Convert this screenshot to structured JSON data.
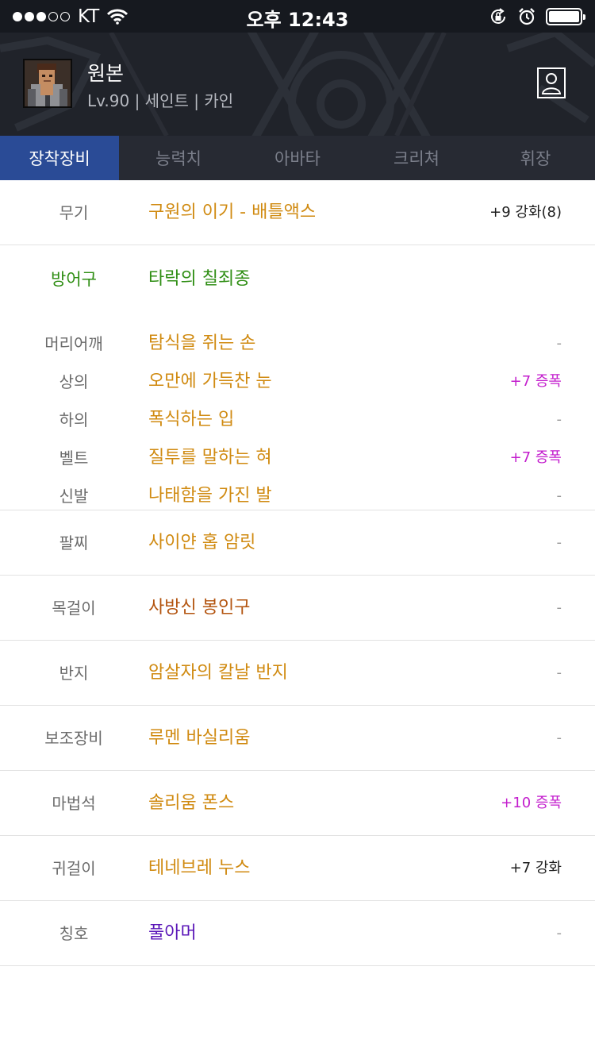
{
  "status_bar": {
    "carrier": "KT",
    "time": "오후 12:43",
    "signal_bars_filled": 3,
    "signal_bars_total": 5
  },
  "profile": {
    "name": "원본",
    "info": "Lv.90 | 세인트 | 카인"
  },
  "tabs": [
    {
      "label": "장착장비",
      "active": true
    },
    {
      "label": "능력치",
      "active": false
    },
    {
      "label": "아바타",
      "active": false
    },
    {
      "label": "크리쳐",
      "active": false
    },
    {
      "label": "휘장",
      "active": false
    }
  ],
  "equipment": {
    "weapon": {
      "category": "무기",
      "name": "구원의 이기 - 배틀액스",
      "value": "+9 강화(8)"
    },
    "armor": {
      "category": "방어구",
      "set_name": "타락의 칠죄종",
      "items": [
        {
          "category": "머리어깨",
          "name": "탐식을 쥐는 손",
          "value": "-"
        },
        {
          "category": "상의",
          "name": "오만에 가득찬 눈",
          "value": "+7 증폭"
        },
        {
          "category": "하의",
          "name": "폭식하는 입",
          "value": "-"
        },
        {
          "category": "벨트",
          "name": "질투를 말하는 혀",
          "value": "+7 증폭"
        },
        {
          "category": "신발",
          "name": "나태함을 가진 발",
          "value": "-"
        }
      ]
    },
    "others": [
      {
        "category": "팔찌",
        "name": "사이얀 홉 암릿",
        "value": "-",
        "name_color": "#d08a10"
      },
      {
        "category": "목걸이",
        "name": "사방신 봉인구",
        "value": "-",
        "name_color": "#b3540f"
      },
      {
        "category": "반지",
        "name": "암살자의 칼날 반지",
        "value": "-",
        "name_color": "#d08a10"
      },
      {
        "category": "보조장비",
        "name": "루멘 바실리움",
        "value": "-",
        "name_color": "#d08a10"
      },
      {
        "category": "마법석",
        "name": "솔리움 폰스",
        "value": "+10 증폭",
        "name_color": "#d08a10"
      },
      {
        "category": "귀걸이",
        "name": "테네브레 누스",
        "value": "+7 강화",
        "name_color": "#d08a10"
      },
      {
        "category": "칭호",
        "name": "풀아머",
        "value": "-",
        "name_color": "#5a16b8"
      }
    ]
  },
  "colors": {
    "epic": "#d08a10",
    "legendary": "#b3540f",
    "unique": "#5a16b8",
    "set": "#2f8e14",
    "amplify": "#c31dcd",
    "tab_active": "#2a4b96"
  }
}
